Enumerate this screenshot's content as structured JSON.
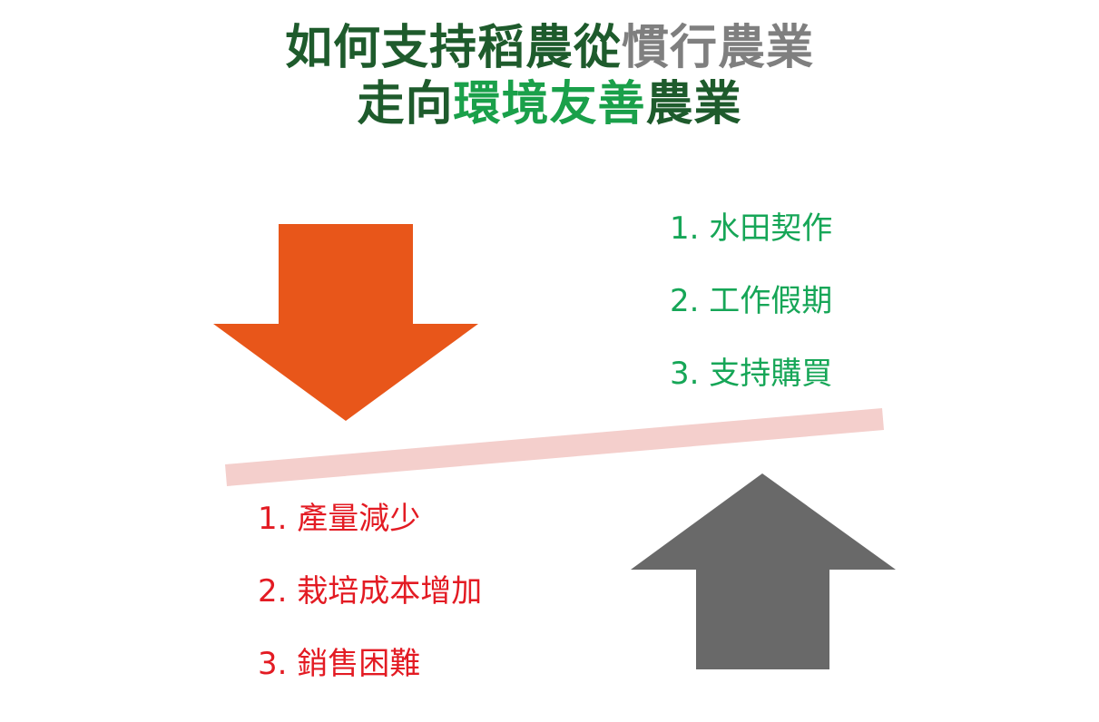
{
  "title": {
    "line1_part1": "如何支持稻農從",
    "line1_part2": "慣行農業",
    "line2_part1": "走向",
    "line2_part2": "環境友善",
    "line2_part3": "農業"
  },
  "support_list": [
    "1. 水田契作",
    "2. 工作假期",
    "3. 支持購買"
  ],
  "problem_list": [
    "1. 產量減少",
    "2. 栽培成本增加",
    "3. 銷售困難"
  ],
  "colors": {
    "title_dark_green": "#1e5b2c",
    "title_grey": "#7f7f7f",
    "title_bright_green": "#1aa04a",
    "support_text": "#16a657",
    "problem_text": "#e31b23",
    "down_arrow": "#e8561a",
    "up_arrow": "#696969",
    "balance_bar": "#f4cfcc"
  },
  "icons": {
    "down_arrow": "orange-down-arrow-icon",
    "up_arrow": "grey-up-arrow-icon"
  }
}
